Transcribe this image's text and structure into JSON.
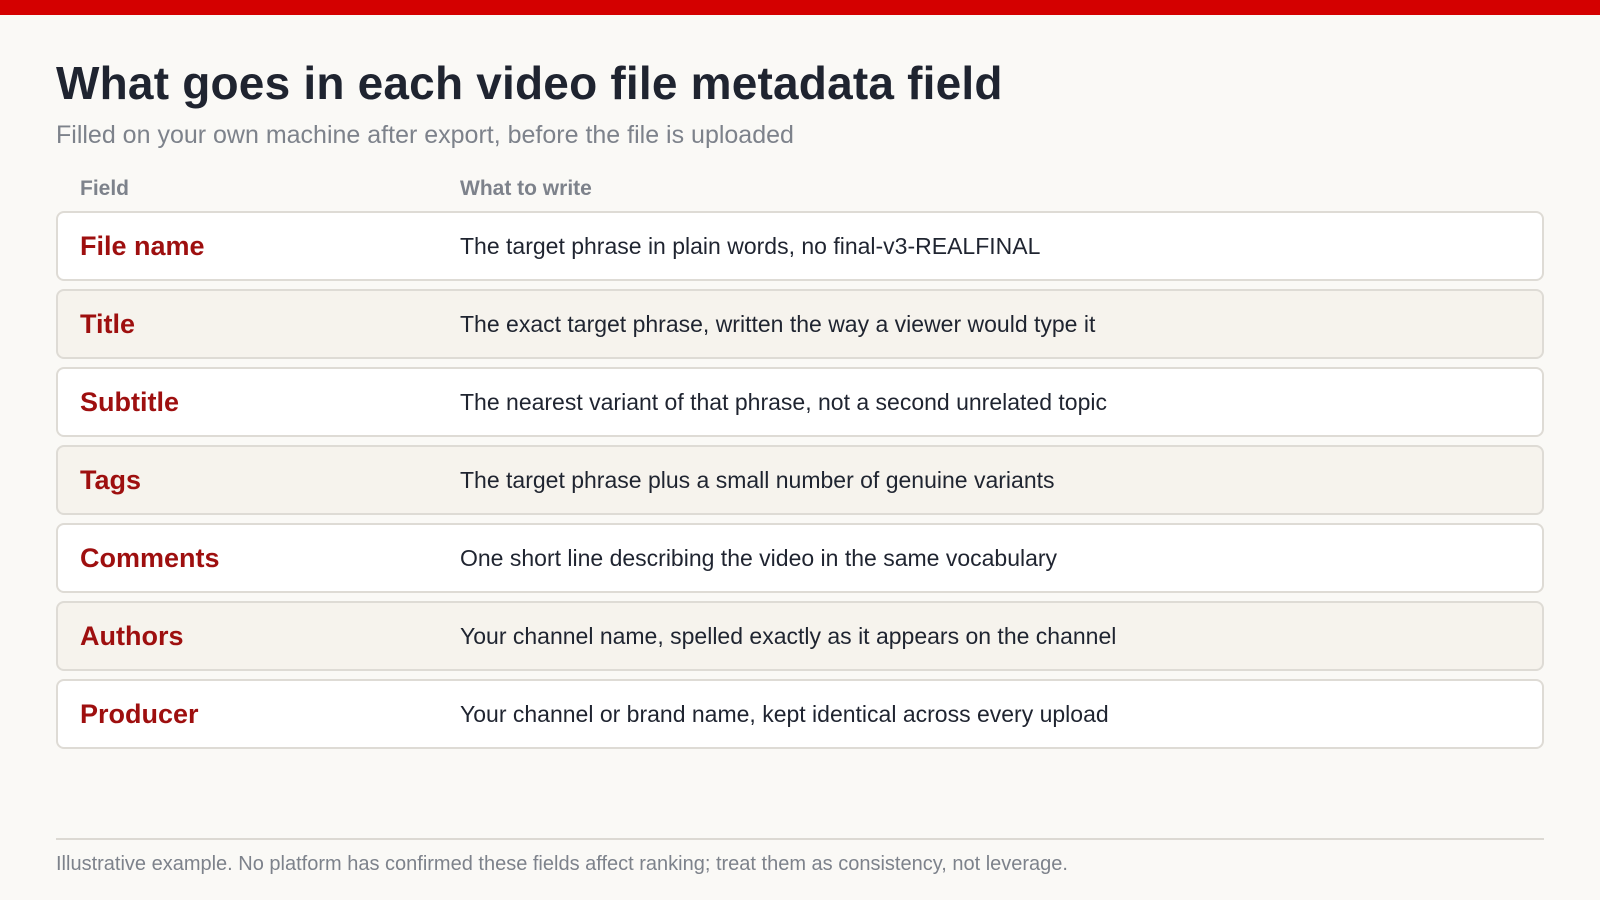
{
  "header": {
    "title": "What goes in each video file metadata field",
    "subtitle": "Filled on your own machine after export, before the file is uploaded"
  },
  "table": {
    "columns": {
      "field": "Field",
      "what": "What to write"
    },
    "rows": [
      {
        "field": "File name",
        "what": "The target phrase in plain words, no final-v3-REALFINAL"
      },
      {
        "field": "Title",
        "what": "The exact target phrase, written the way a viewer would type it"
      },
      {
        "field": "Subtitle",
        "what": "The nearest variant of that phrase, not a second unrelated topic"
      },
      {
        "field": "Tags",
        "what": "The target phrase plus a small number of genuine variants"
      },
      {
        "field": "Comments",
        "what": "One short line describing the video in the same vocabulary"
      },
      {
        "field": "Authors",
        "what": "Your channel name, spelled exactly as it appears on the channel"
      },
      {
        "field": "Producer",
        "what": "Your channel or brand name, kept identical across every upload"
      }
    ]
  },
  "footer": {
    "note": "Illustrative example. No platform has confirmed these fields affect ranking; treat them as consistency, not leverage."
  },
  "colors": {
    "accent_bar": "#d40000",
    "field_name": "#9e0f0f",
    "title_text": "#1f2430",
    "muted_text": "#7d828b",
    "row_bg": "#ffffff",
    "row_alt_bg": "#f6f3ed",
    "page_bg": "#faf9f6"
  }
}
